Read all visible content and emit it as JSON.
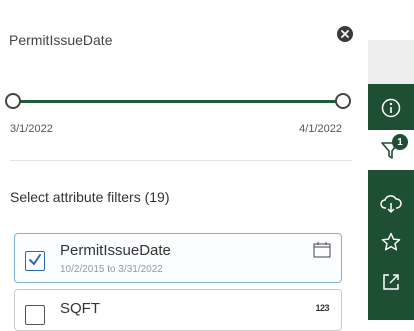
{
  "filter": {
    "field_name": "PermitIssueDate",
    "slider_min_label": "3/1/2022",
    "slider_max_label": "4/1/2022",
    "slider_lower_fraction": 0,
    "slider_upper_fraction": 1
  },
  "attribute_filters": {
    "heading": "Select attribute filters (19)",
    "items": [
      {
        "name": "PermitIssueDate",
        "range": "10/2/2015 to 3/31/2022",
        "checked": true,
        "type_icon": "calendar-icon"
      },
      {
        "name": "SQFT",
        "type_label": "123",
        "checked": false,
        "type_icon": "number-type-icon"
      }
    ]
  },
  "sidebar": {
    "filter_badge": "1",
    "buttons": [
      "info-icon",
      "filter-icon",
      "download-icon",
      "star-icon",
      "share-icon"
    ]
  },
  "colors": {
    "accent_green": "#1f4f33",
    "slider_track": "#1f5a36",
    "checkbox_blue": "#2a6bb0"
  }
}
